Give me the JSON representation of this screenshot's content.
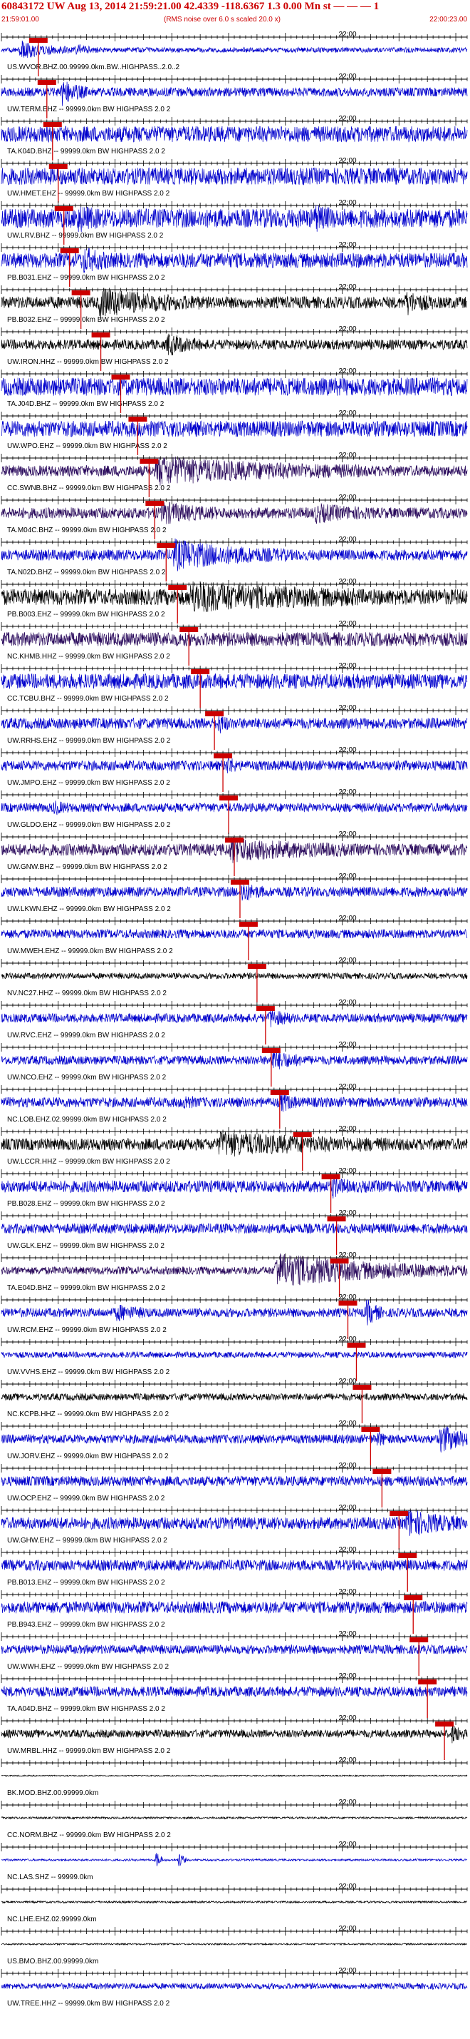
{
  "header": {
    "title": "60843172 UW Aug 13, 2014 21:59:21.00   42.4339 -118.6367  1.3 0.00 Mn st — — — 1",
    "start_time": "21:59:01.00",
    "note": "(RMS noise over 6.0 s scaled 20.0 x)",
    "end_time": "22:00:23.00"
  },
  "colors": {
    "red": "#cc0000",
    "blue": "#0000cc",
    "black": "#000000",
    "purple": "#2a0a5c",
    "axis": "#000000"
  },
  "chart_data": {
    "type": "line",
    "title": "60843172 UW Aug 13, 2014 21:59:21.00   42.4339 -118.6367  1.3 0.00 Mn st",
    "x_range_seconds": [
      0,
      82
    ],
    "minute_mark_label": "22:00",
    "minute_mark_second": 59,
    "traces": [
      {
        "label": "US.WVOR.BHZ.00.99999.0km.BW..HIGHPASS..2.0..2",
        "color": "blue",
        "amp": 0.25,
        "pick": 6.5,
        "events": [
          [
            3,
            10,
            0.8
          ],
          [
            13,
            4,
            0.5
          ]
        ]
      },
      {
        "label": "UW.TERM.EHZ -- 99999.0km BW  HIGHPASS  2.0  2",
        "color": "blue",
        "amp": 0.45,
        "pick": 8.0,
        "events": [
          [
            10.2,
            5,
            1.2
          ]
        ]
      },
      {
        "label": "TA.K04D.BHZ -- 99999.0km BW  HIGHPASS  2.0  2",
        "color": "blue",
        "amp": 0.8,
        "pick": 9.0,
        "events": []
      },
      {
        "label": "UW.HMET.EHZ -- 99999.0km BW  HIGHPASS  2.0  2",
        "color": "blue",
        "amp": 0.85,
        "pick": 10.0,
        "events": []
      },
      {
        "label": "UW.LRV.BHZ -- 99999.0km BW  HIGHPASS  2.0  2",
        "color": "blue",
        "amp": 0.95,
        "pick": 11.0,
        "events": [
          [
            13,
            4,
            0.8
          ],
          [
            55,
            4,
            0.7
          ]
        ]
      },
      {
        "label": "PB.B031.EHZ -- 99999.0km BW  HIGHPASS  2.0  2",
        "color": "blue",
        "amp": 0.75,
        "pick": 12.0,
        "events": [
          [
            14,
            5,
            0.9
          ]
        ]
      },
      {
        "label": "PB.B032.EHZ -- 99999.0km BW  HIGHPASS  2.0  2",
        "color": "black",
        "amp": 0.6,
        "pick": 14.0,
        "events": [
          [
            17,
            18,
            1.1
          ],
          [
            71,
            5,
            0.9
          ]
        ]
      },
      {
        "label": "UW.IRON.HHZ -- 99999.0km BW  HIGHPASS  2.0  2",
        "color": "black",
        "amp": 0.5,
        "pick": 17.5,
        "events": [
          [
            29,
            6,
            0.9
          ]
        ]
      },
      {
        "label": "TA.J04D.BHZ -- 99999.0km BW  HIGHPASS  2.0  2",
        "color": "blue",
        "amp": 0.9,
        "pick": 21.0,
        "events": []
      },
      {
        "label": "UW.WPO.EHZ -- 99999.0km BW  HIGHPASS  2.0  2",
        "color": "blue",
        "amp": 0.8,
        "pick": 24.0,
        "events": []
      },
      {
        "label": "CC.SWNB.BHZ -- 99999.0km BW  HIGHPASS  2.0  2",
        "color": "purple",
        "amp": 0.55,
        "pick": 26.0,
        "events": [
          [
            27,
            36,
            1.1
          ]
        ]
      },
      {
        "label": "TA.M04C.BHZ -- 99999.0km BW  HIGHPASS  2.0  2",
        "color": "purple",
        "amp": 0.55,
        "pick": 27.0,
        "events": [
          [
            28,
            10,
            0.8
          ],
          [
            55,
            10,
            0.6
          ]
        ]
      },
      {
        "label": "TA.N02D.BHZ -- 99999.0km BW  HIGHPASS  2.0  2",
        "color": "blue",
        "amp": 0.55,
        "pick": 29.0,
        "events": [
          [
            30,
            20,
            1.2
          ]
        ]
      },
      {
        "label": "PB.B003.EHZ -- 99999.0km BW  HIGHPASS  2.0  2",
        "color": "black",
        "amp": 0.8,
        "pick": 31.0,
        "events": [
          [
            33,
            30,
            1.0
          ]
        ]
      },
      {
        "label": "NC.KHMB.HHZ -- 99999.0km BW  HIGHPASS  2.0  2",
        "color": "purple",
        "amp": 0.7,
        "pick": 33.0,
        "events": []
      },
      {
        "label": "CC.TCBU.BHZ -- 99999.0km BW  HIGHPASS  2.0  2",
        "color": "blue",
        "amp": 0.75,
        "pick": 35.0,
        "events": []
      },
      {
        "label": "UW.RRHS.EHZ -- 99999.0km BW  HIGHPASS  2.0  2",
        "color": "blue",
        "amp": 0.55,
        "pick": 37.5,
        "events": [
          [
            38,
            2,
            0.9
          ]
        ]
      },
      {
        "label": "UW.JMPO.EHZ -- 99999.0km BW  HIGHPASS  2.0  2",
        "color": "blue",
        "amp": 0.5,
        "pick": 39.0,
        "events": [
          [
            39.5,
            2,
            0.9
          ]
        ]
      },
      {
        "label": "UW.GLDO.EHZ -- 99999.0km BW  HIGHPASS  2.0  2",
        "color": "blue",
        "amp": 0.45,
        "pick": 40.0,
        "events": [
          [
            9,
            3,
            0.5
          ]
        ]
      },
      {
        "label": "UW.GNW.BHZ -- 99999.0km BW  HIGHPASS  2.0  2",
        "color": "purple",
        "amp": 0.6,
        "pick": 41.0,
        "events": [
          [
            40,
            20,
            0.8
          ]
        ]
      },
      {
        "label": "UW.LKWN.EHZ -- 99999.0km BW  HIGHPASS  2.0  2",
        "color": "blue",
        "amp": 0.5,
        "pick": 42.0,
        "events": [
          [
            42,
            4,
            0.9
          ]
        ]
      },
      {
        "label": "UW.MWEH.EHZ -- 99999.0km BW  HIGHPASS  2.0  2",
        "color": "blue",
        "amp": 0.45,
        "pick": 43.5,
        "events": []
      },
      {
        "label": "NV.NC27.HHZ -- 99999.0km BW  HIGHPASS  2.0  2",
        "color": "black",
        "amp": 0.3,
        "pick": 45.0,
        "events": []
      },
      {
        "label": "UW.RVC.EHZ -- 99999.0km BW  HIGHPASS  2.0  2",
        "color": "blue",
        "amp": 0.45,
        "pick": 46.5,
        "events": [
          [
            47,
            4,
            0.8
          ]
        ]
      },
      {
        "label": "UW.NCO.EHZ -- 99999.0km BW  HIGHPASS  2.0  2",
        "color": "blue",
        "amp": 0.45,
        "pick": 47.5,
        "events": [
          [
            47.5,
            6,
            0.9
          ]
        ]
      },
      {
        "label": "NC.LOB.EHZ.02.99999.0km BW  HIGHPASS  2.0  2",
        "color": "blue",
        "amp": 0.5,
        "pick": 49.0,
        "events": [
          [
            32,
            2,
            0.7
          ],
          [
            49,
            3,
            0.9
          ]
        ]
      },
      {
        "label": "UW.LCCR.HHZ -- 99999.0km BW  HIGHPASS  2.0  2",
        "color": "black",
        "amp": 0.6,
        "pick": 53.0,
        "events": [
          [
            38,
            30,
            0.8
          ]
        ]
      },
      {
        "label": "PB.B028.EHZ -- 99999.0km BW  HIGHPASS  2.0  2",
        "color": "blue",
        "amp": 0.6,
        "pick": 58.0,
        "events": [
          [
            58,
            3,
            0.9
          ]
        ]
      },
      {
        "label": "UW.GLK.EHZ -- 99999.0km BW  HIGHPASS  2.0  2",
        "color": "blue",
        "amp": 0.5,
        "pick": 59.0,
        "events": []
      },
      {
        "label": "TA.E04D.BHZ -- 99999.0km BW  HIGHPASS  2.0  2",
        "color": "purple",
        "amp": 0.4,
        "pick": 59.5,
        "events": [
          [
            48,
            34,
            1.5
          ]
        ]
      },
      {
        "label": "UW.RCM.EHZ -- 99999.0km BW  HIGHPASS  2.0  2",
        "color": "blue",
        "amp": 0.45,
        "pick": 61.0,
        "events": [
          [
            20,
            6,
            0.6
          ],
          [
            64,
            3,
            1.4
          ]
        ]
      },
      {
        "label": "UW.VVHS.EHZ -- 99999.0km BW  HIGHPASS  2.0  2",
        "color": "blue",
        "amp": 0.3,
        "pick": 62.5,
        "events": []
      },
      {
        "label": "NC.KCPB.HHZ -- 99999.0km BW  HIGHPASS  2.0  2",
        "color": "black",
        "amp": 0.35,
        "pick": 63.5,
        "events": []
      },
      {
        "label": "UW.JORV.EHZ -- 99999.0km BW  HIGHPASS  2.0  2",
        "color": "blue",
        "amp": 0.45,
        "pick": 65.0,
        "events": [
          [
            66,
            2,
            0.7
          ],
          [
            77,
            8,
            1.2
          ]
        ]
      },
      {
        "label": "UW.OCP.EHZ -- 99999.0km BW  HIGHPASS  2.0  2",
        "color": "blue",
        "amp": 0.5,
        "pick": 67.0,
        "events": []
      },
      {
        "label": "UW.GHW.EHZ -- 99999.0km BW  HIGHPASS  2.0  2",
        "color": "blue",
        "amp": 0.6,
        "pick": 70.0,
        "events": [
          [
            71,
            10,
            1.1
          ]
        ]
      },
      {
        "label": "PB.B013.EHZ -- 99999.0km BW  HIGHPASS  2.0  2",
        "color": "blue",
        "amp": 0.55,
        "pick": 71.5,
        "events": []
      },
      {
        "label": "PB.B943.EHZ -- 99999.0km BW  HIGHPASS  2.0  2",
        "color": "blue",
        "amp": 0.6,
        "pick": 72.5,
        "events": []
      },
      {
        "label": "UW.WWH.EHZ -- 99999.0km BW  HIGHPASS  2.0  2",
        "color": "blue",
        "amp": 0.45,
        "pick": 73.5,
        "events": []
      },
      {
        "label": "TA.A04D.BHZ -- 99999.0km BW  HIGHPASS  2.0  2",
        "color": "blue",
        "amp": 0.5,
        "pick": 75.0,
        "events": []
      },
      {
        "label": "UW.MRBL.HHZ -- 99999.0km BW  HIGHPASS  2.0  2",
        "color": "black",
        "amp": 0.4,
        "pick": 78.0,
        "events": [
          [
            79,
            3,
            0.9
          ]
        ]
      },
      {
        "label": "BK.MOD.BHZ.00.99999.0km",
        "color": "black",
        "amp": 0.06,
        "pick": null,
        "events": []
      },
      {
        "label": "CC.NORM.BHZ -- 99999.0km BW  HIGHPASS  2.0  2",
        "color": "black",
        "amp": 0.1,
        "pick": null,
        "events": []
      },
      {
        "label": "NC.LAS.SHZ -- 99999.0km",
        "color": "blue",
        "amp": 0.1,
        "pick": null,
        "events": [
          [
            27,
            1.5,
            1.4
          ],
          [
            31,
            1.5,
            1.3
          ]
        ]
      },
      {
        "label": "NC.LHE.EHZ.02.99999.0km",
        "color": "black",
        "amp": 0.1,
        "pick": null,
        "events": []
      },
      {
        "label": "US.BMO.BHZ.00.99999.0km",
        "color": "black",
        "amp": 0.08,
        "pick": null,
        "events": []
      },
      {
        "label": "UW.TREE.HHZ -- 99999.0km BW  HIGHPASS  2.0  2",
        "color": "blue",
        "amp": 0.3,
        "pick": null,
        "events": []
      }
    ]
  }
}
